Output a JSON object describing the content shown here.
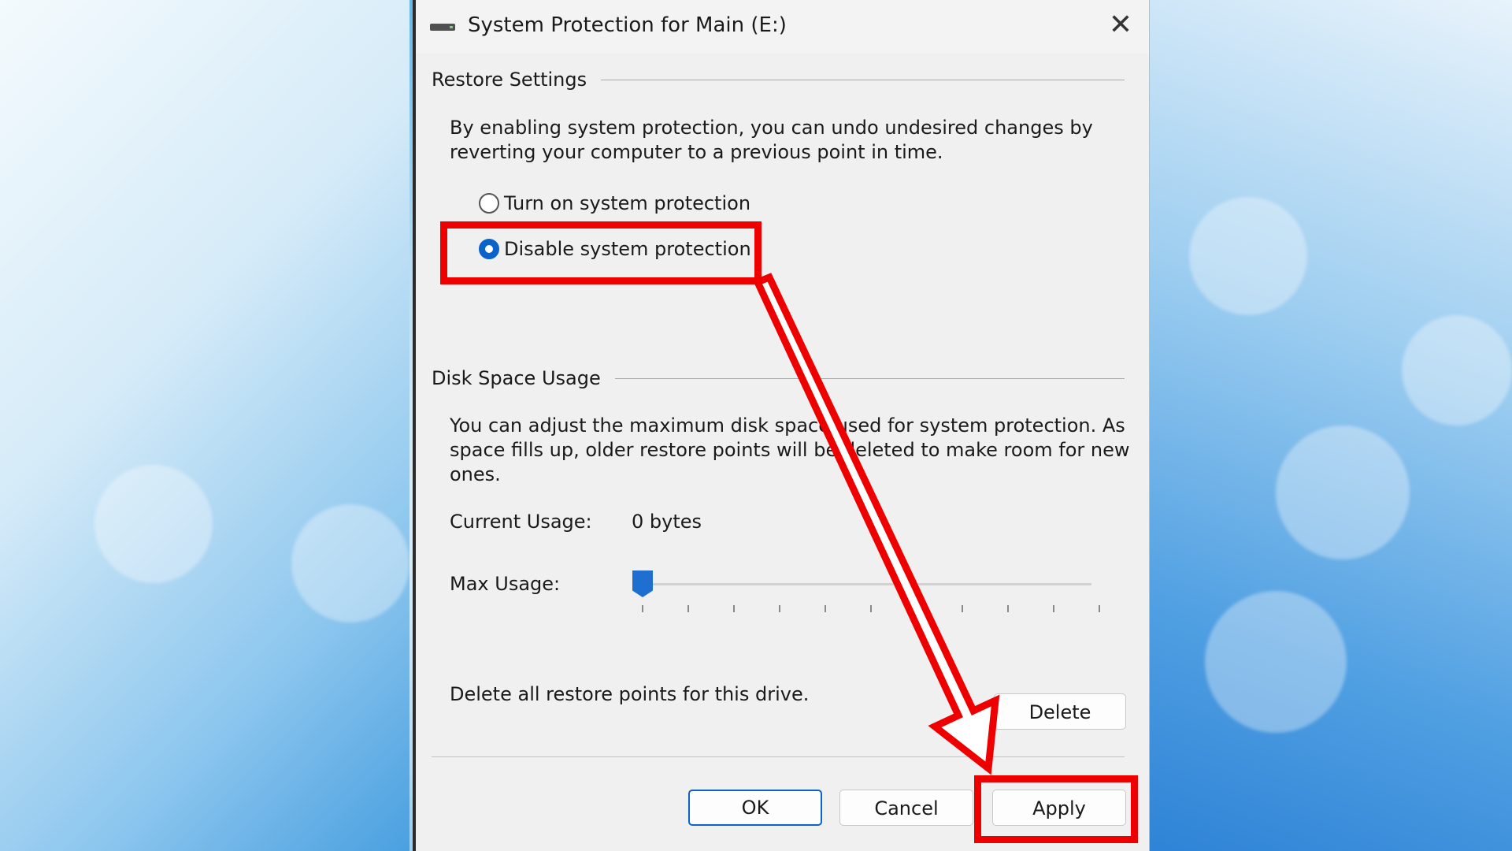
{
  "dialog": {
    "title": "System Protection for Main (E:)",
    "close_glyph": "✕"
  },
  "restore_settings": {
    "heading": "Restore Settings",
    "description_line1": "By enabling system protection, you can undo undesired changes by",
    "description_line2": "reverting your computer to a previous point in time.",
    "options": [
      {
        "label": "Turn on system protection",
        "selected": false
      },
      {
        "label": "Disable system protection",
        "selected": true
      }
    ]
  },
  "disk_space": {
    "heading": "Disk Space Usage",
    "description_line1": "You can adjust the maximum disk space used for system protection. As",
    "description_line2": "space fills up, older restore points will be deleted to make room for new",
    "description_line3": "ones.",
    "current_usage_label": "Current Usage:",
    "current_usage_value": "0 bytes",
    "max_usage_label": "Max Usage:",
    "max_usage_level": 0,
    "delete_text": "Delete all restore points for this drive.",
    "delete_button": "Delete"
  },
  "footer": {
    "ok": "OK",
    "cancel": "Cancel",
    "apply": "Apply"
  },
  "annotation": {
    "color": "#ef0000",
    "highlighted": [
      "Disable system protection",
      "Apply"
    ]
  }
}
